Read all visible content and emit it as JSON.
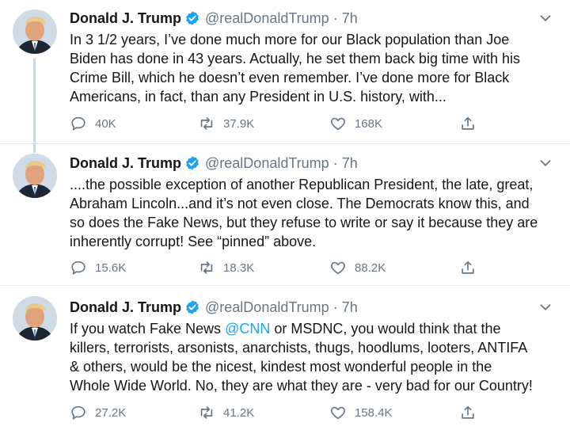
{
  "tweets": [
    {
      "name": "Donald J. Trump",
      "handle": "@realDonaldTrump",
      "dot": "·",
      "time": "7h",
      "lines": [
        "In 3 1/2 years, I’ve done much more for our Black population than Joe",
        "Biden has done in 43 years. Actually, he set them back big time with his",
        "Crime Bill, which he doesn’t even remember. I’ve done more for Black",
        "Americans, in fact, than any President in U.S. history, with..."
      ],
      "replies": "40K",
      "retweets": "37.9K",
      "likes": "168K"
    },
    {
      "name": "Donald J. Trump",
      "handle": "@realDonaldTrump",
      "dot": "·",
      "time": "7h",
      "lines": [
        "....the possible exception of another Republican President, the late, great,",
        "Abraham Lincoln...and it’s not even close. The Democrats know this, and",
        "so does the Fake News, but they refuse to write or say it because they are",
        "inherently corrupt! See “pinned” above."
      ],
      "replies": "15.6K",
      "retweets": "18.3K",
      "likes": "88.2K"
    },
    {
      "name": "Donald J. Trump",
      "handle": "@realDonaldTrump",
      "dot": "·",
      "time": "7h",
      "line1_before": "If you watch Fake News ",
      "line1_mention": "@CNN",
      "line1_after": " or MSDNC, you would think that the",
      "lines": [
        "killers, terrorists, arsonists, anarchists, thugs, hoodlums, looters, ANTIFA",
        "& others, would be the nicest, kindest most wonderful people in the",
        "Whole Wide World. No, they are what they are - very bad for our Country!"
      ],
      "replies": "27.2K",
      "retweets": "41.2K",
      "likes": "158.4K"
    }
  ],
  "colors": {
    "text": "#14171a",
    "secondary": "#657786",
    "link": "#1da1f2",
    "verified": "#1da1f2",
    "divider": "#e6ecf0",
    "thread_line": "#ccd6dd"
  },
  "icons": [
    "verified-badge-icon",
    "chevron-down-icon",
    "reply-icon",
    "retweet-icon",
    "like-icon",
    "share-icon"
  ]
}
